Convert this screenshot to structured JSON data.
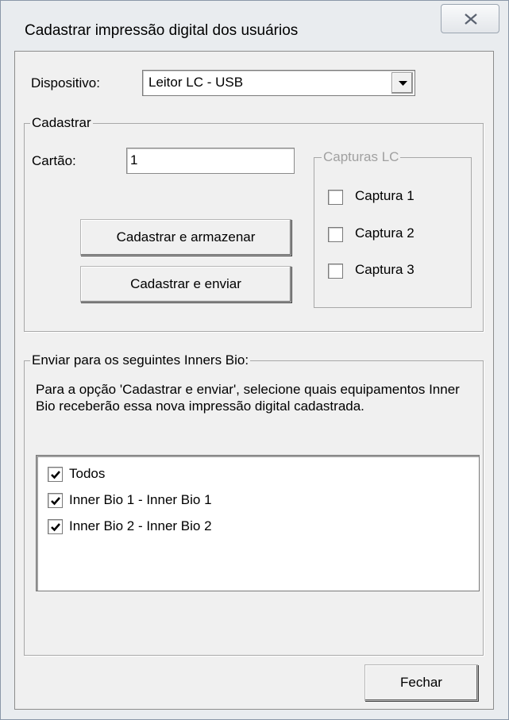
{
  "window": {
    "title": "Cadastrar impressão digital dos usuários",
    "close_glyph": "close-icon"
  },
  "device": {
    "label": "Dispositivo:",
    "selected": "Leitor LC - USB"
  },
  "register_group": {
    "title": "Cadastrar",
    "card_label": "Cartão:",
    "card_value": "1",
    "store_button": "Cadastrar e armazenar",
    "send_button": "Cadastrar e enviar"
  },
  "captures_group": {
    "title": "Capturas LC",
    "items": [
      {
        "label": "Captura 1",
        "checked": false
      },
      {
        "label": "Captura 2",
        "checked": false
      },
      {
        "label": "Captura 3",
        "checked": false
      }
    ]
  },
  "send_group": {
    "title": "Enviar para os seguintes Inners Bio:",
    "description": "Para a opção 'Cadastrar e enviar', selecione quais equipamentos Inner Bio receberão essa nova impressão digital cadastrada.",
    "items": [
      {
        "label": "Todos",
        "checked": true
      },
      {
        "label": "Inner Bio 1 - Inner Bio 1",
        "checked": true
      },
      {
        "label": "Inner Bio 2 - Inner Bio 2",
        "checked": true
      }
    ]
  },
  "footer": {
    "close_button": "Fechar"
  }
}
